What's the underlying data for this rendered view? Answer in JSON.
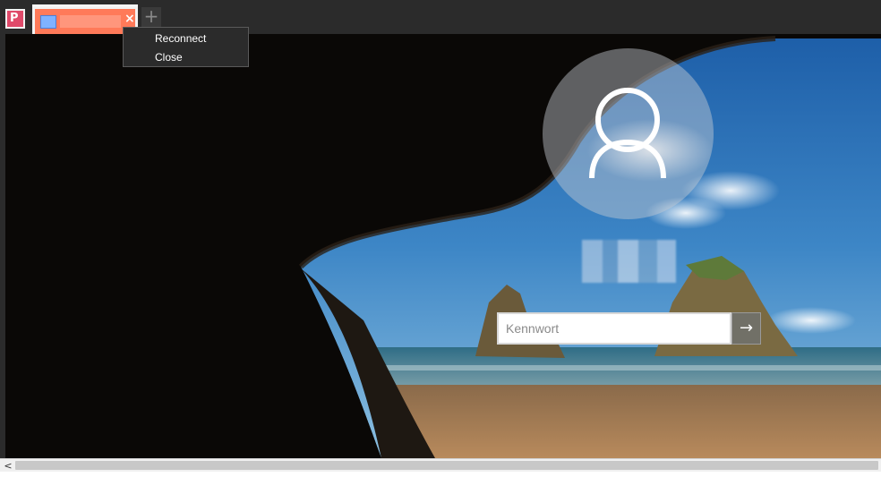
{
  "app": {
    "icon_letter": "P",
    "brand_color": "#e04a6a"
  },
  "tabs": [
    {
      "title": "",
      "close_glyph": "×",
      "accent": "#ff7a59"
    }
  ],
  "tab_add_glyph": "+",
  "context_menu": {
    "items": [
      "Reconnect",
      "Close"
    ]
  },
  "login": {
    "username": "",
    "password_value": "",
    "password_placeholder": "Kennwort",
    "submit_glyph": "→"
  },
  "scrollbar": {
    "left_arrow": "<"
  },
  "icons": {
    "app": "app-logo-icon",
    "tab_thumb": "remote-desktop-icon",
    "close": "close-icon",
    "add": "plus-icon",
    "user": "user-icon",
    "arrow": "arrow-right-icon"
  }
}
